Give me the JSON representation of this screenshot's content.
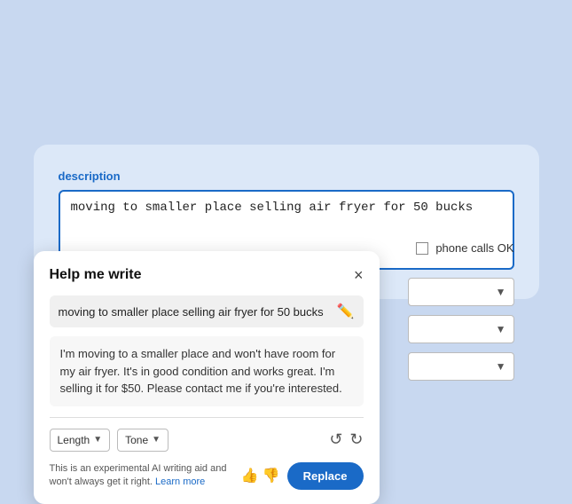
{
  "outer": {
    "description_label": "description",
    "textarea_value": "moving to smaller place selling air fryer for 50 bucks"
  },
  "dropdowns": [
    {
      "label": ""
    },
    {
      "label": ""
    },
    {
      "label": ""
    }
  ],
  "contact": {
    "label": "phone calls OK"
  },
  "modal": {
    "title": "Help me write",
    "close_label": "×",
    "input_text": "moving to smaller place selling air fryer for 50 bucks",
    "generated_text": "I'm moving to a smaller place and won't have room for my air fryer. It's in good condition and works great. I'm selling it for $50. Please contact me if you're interested.",
    "length_label": "Length",
    "tone_label": "Tone",
    "footer_text": "This is an experimental AI writing aid and won't always get it right.",
    "learn_more": "Learn more",
    "replace_label": "Replace"
  }
}
